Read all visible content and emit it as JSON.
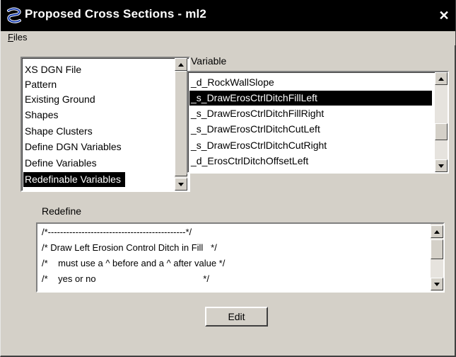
{
  "window": {
    "title": "Proposed Cross Sections - ml2",
    "close_symbol": "✕",
    "icon": "app-logo-icon"
  },
  "menu": {
    "files_first": "F",
    "files_rest": "iles"
  },
  "left_list": {
    "items": [
      "XS DGN File",
      "Pattern",
      "Existing Ground",
      "Shapes",
      "Shape Clusters",
      "Define DGN Variables",
      "Define Variables",
      "Redefinable Variables"
    ],
    "selected_index": 7
  },
  "variable": {
    "label": "Variable",
    "items": [
      "_d_RockWallSlope",
      "_s_DrawErosCtrlDitchFillLeft",
      "_s_DrawErosCtrlDitchFillRight",
      "_s_DrawErosCtrlDitchCutLeft",
      "_s_DrawErosCtrlDitchCutRight",
      "_d_ErosCtrlDitchOffsetLeft"
    ],
    "selected_index": 1
  },
  "redefine": {
    "label": "Redefine",
    "lines": [
      "/*---------------------------------------------*/",
      "/* Draw Left Erosion Control Ditch in Fill   */",
      "/*    must use a ^ before and a ^ after value */",
      "/*    yes or no                                          */"
    ]
  },
  "edit_button": {
    "label": "Edit"
  },
  "colors": {
    "titlebar": "#000000",
    "face": "#d4d0c8",
    "selection": "#000000",
    "logo_blue": "#1a3fb0"
  }
}
